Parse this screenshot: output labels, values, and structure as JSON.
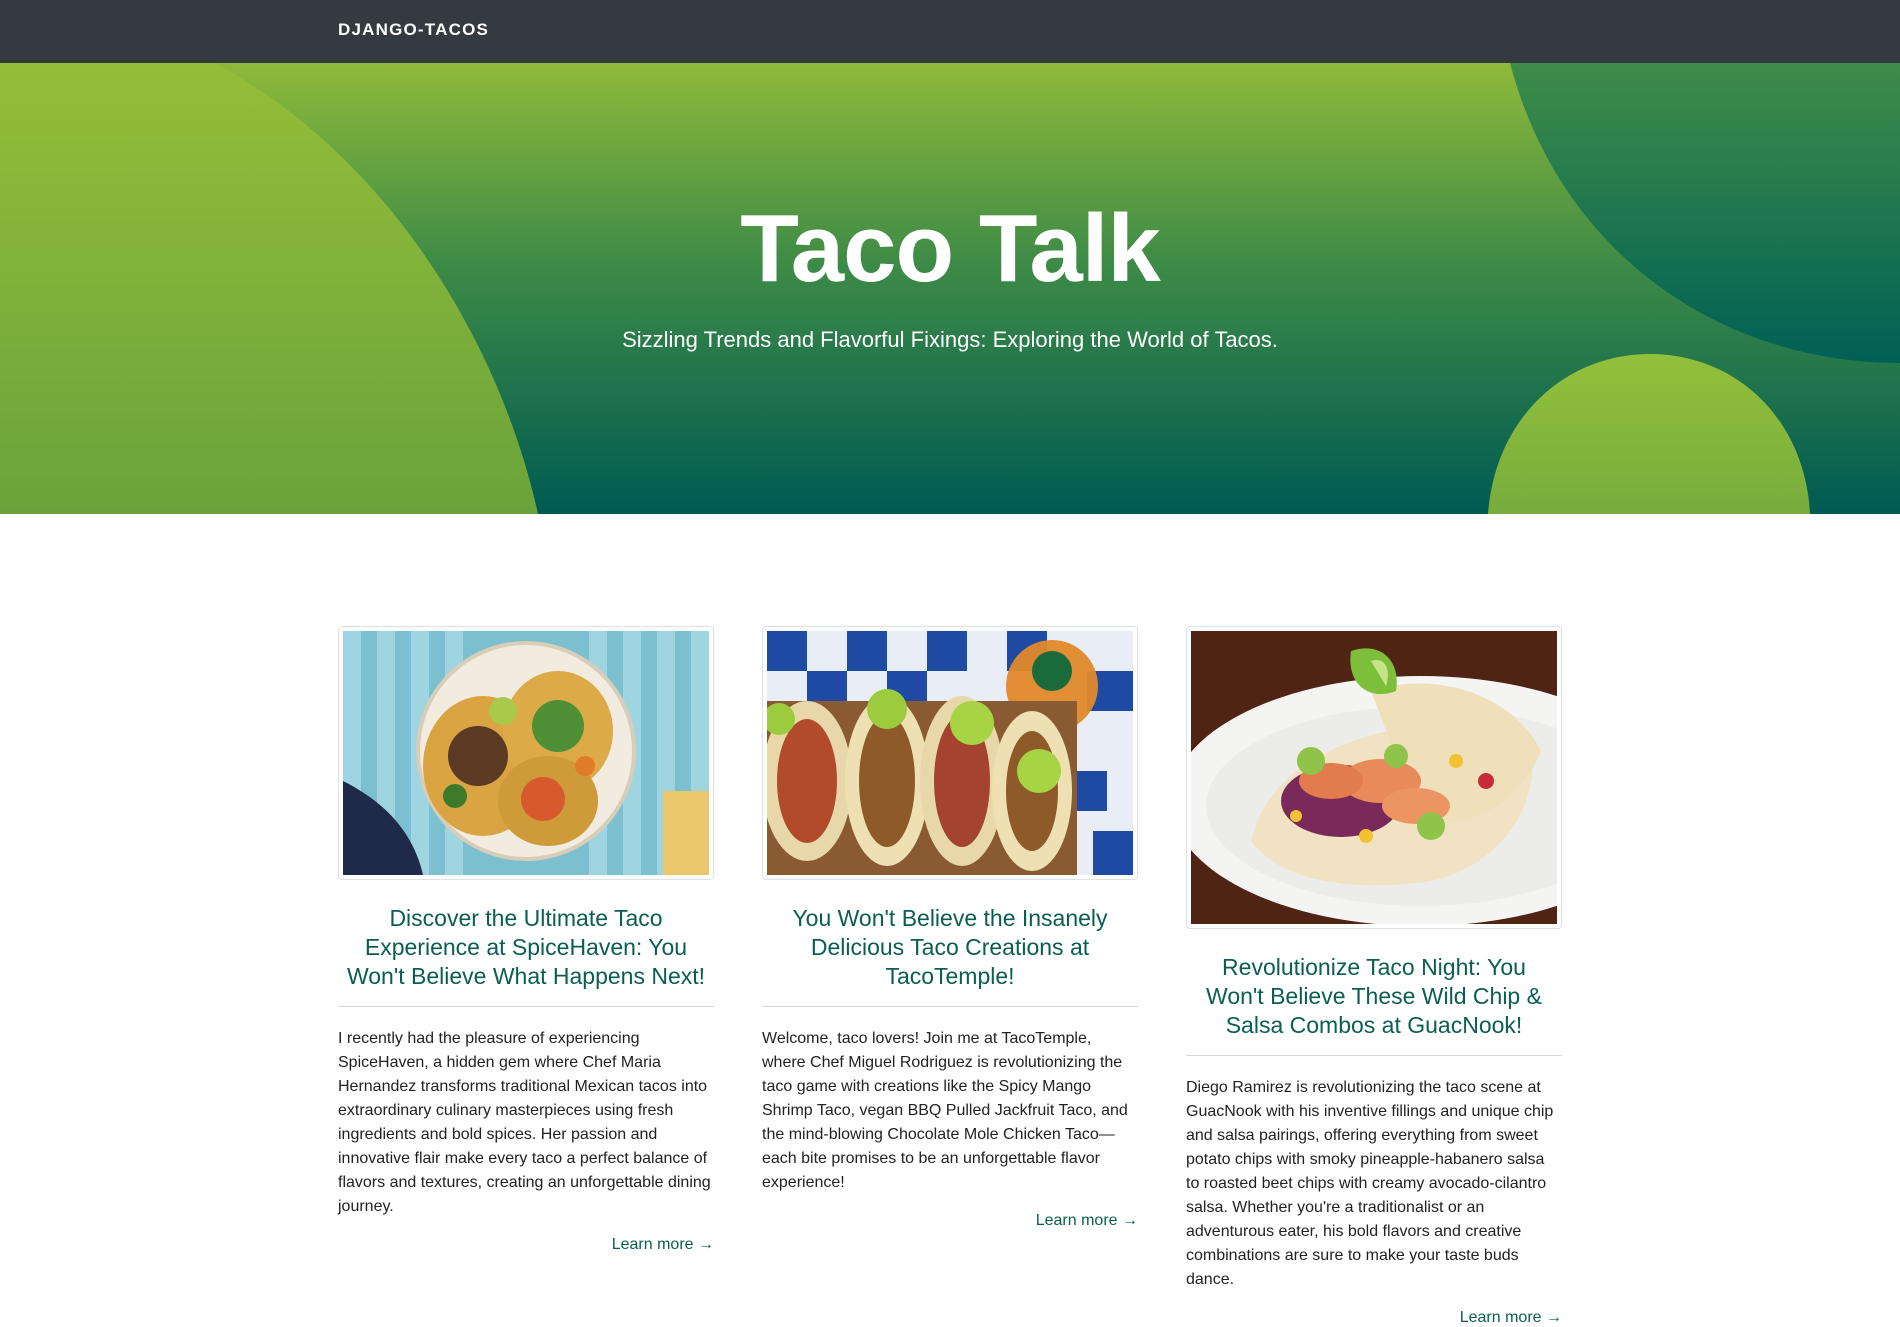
{
  "navbar": {
    "brand": "DJANGO-TACOS"
  },
  "hero": {
    "title": "Taco Talk",
    "subtitle": "Sizzling Trends and Flavorful Fixings: Exploring the World of Tacos."
  },
  "posts": [
    {
      "title": "Discover the Ultimate Taco Experience at SpiceHaven: You Won't Believe What Happens Next!",
      "body": "I recently had the pleasure of experiencing SpiceHaven, a hidden gem where Chef Maria Hernandez transforms traditional Mexican tacos into extraordinary culinary masterpieces using fresh ingredients and bold spices. Her passion and innovative flair make every taco a perfect balance of flavors and textures, creating an unforgettable dining journey.",
      "link": "Learn more →"
    },
    {
      "title": "You Won't Believe the Insanely Delicious Taco Creations at TacoTemple!",
      "body": "Welcome, taco lovers! Join me at TacoTemple, where Chef Miguel Rodriguez is revolutionizing the taco game with creations like the Spicy Mango Shrimp Taco, vegan BBQ Pulled Jackfruit Taco, and the mind-blowing Chocolate Mole Chicken Taco—each bite promises to be an unforgettable flavor experience!",
      "link": "Learn more →"
    },
    {
      "title": "Revolutionize Taco Night: You Won't Believe These Wild Chip & Salsa Combos at GuacNook!",
      "body": "Diego Ramirez is revolutionizing the taco scene at GuacNook with his inventive fillings and unique chip and salsa pairings, offering everything from sweet potato chips with smoky pineapple-habanero salsa to roasted beet chips with creamy avocado-cilantro salsa. Whether you're a traditionalist or an adventurous eater, his bold flavors and creative combinations are sure to make your taste buds dance.",
      "link": "Learn more →"
    }
  ],
  "colors": {
    "navbar": "#343a40",
    "hero_top": "#8fba3a",
    "hero_bottom": "#005a52",
    "accent_link": "#0a5e52"
  }
}
